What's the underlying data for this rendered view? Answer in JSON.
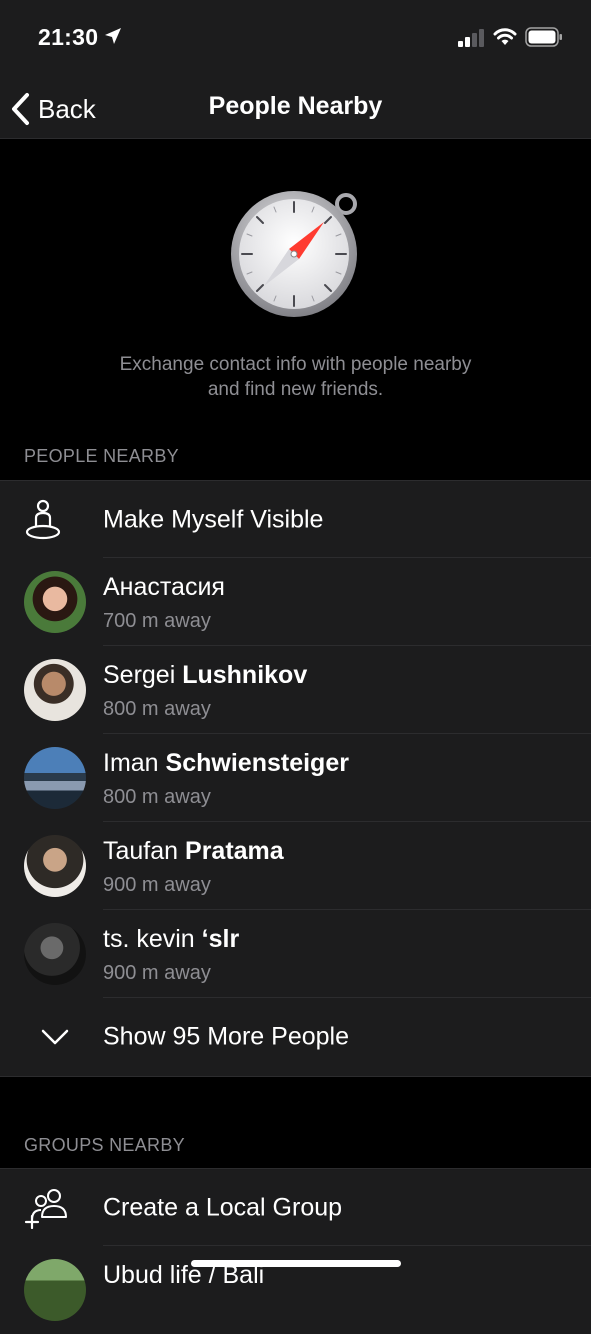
{
  "status": {
    "time": "21:30"
  },
  "nav": {
    "back_label": "Back",
    "title": "People Nearby"
  },
  "intro": {
    "line1": "Exchange contact info with people nearby",
    "line2": "and find new friends."
  },
  "people_section": {
    "header": "PEOPLE NEARBY",
    "make_visible_label": "Make Myself Visible",
    "people": [
      {
        "first": "Анастасия",
        "last": "",
        "distance": "700 m away"
      },
      {
        "first": "Sergei",
        "last": "Lushnikov",
        "distance": "800 m away"
      },
      {
        "first": "Iman",
        "last": "Schwiensteiger",
        "distance": "800 m away"
      },
      {
        "first": "Taufan",
        "last": "Pratama",
        "distance": "900 m away"
      },
      {
        "first": "ts. kevin",
        "last": "‘slr",
        "distance": "900 m away"
      }
    ],
    "show_more_label": "Show 95 More People"
  },
  "groups_section": {
    "header": "GROUPS NEARBY",
    "create_label": "Create a Local Group",
    "groups": [
      {
        "name": "Ubud life / Bali"
      }
    ]
  },
  "colors": {
    "background": "#000000",
    "surface": "#1c1c1d",
    "secondary_text": "#8e8e93",
    "compass_needle": "#ff3b30"
  }
}
